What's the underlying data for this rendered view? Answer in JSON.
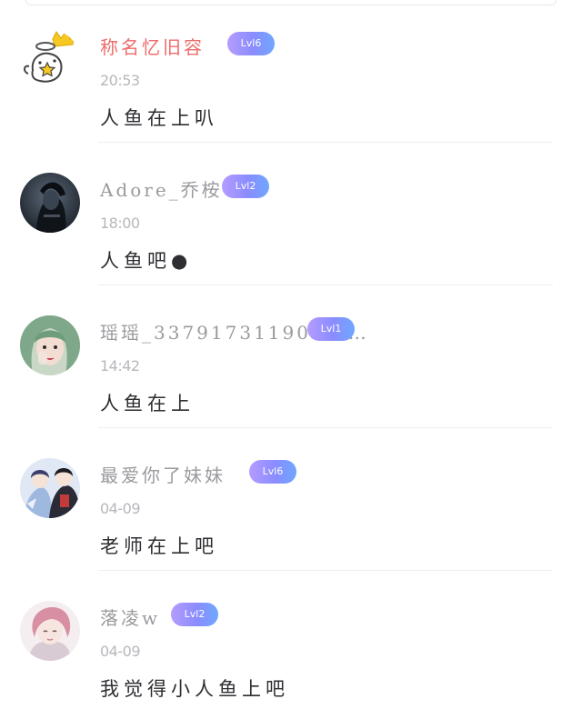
{
  "comments": [
    {
      "username": "称名忆旧容",
      "level": "Lvl6",
      "time": "20:53",
      "content": "人鱼在上叭",
      "avatar_icon": "angel-ghost-with-crown",
      "name_color": "#ef6b6b"
    },
    {
      "username": "Adore_乔桉",
      "level": "Lvl2",
      "time": "18:00",
      "content": "人鱼吧●",
      "avatar_icon": "dark-anime-portrait"
    },
    {
      "username": "瑶瑶_3379173119011 …",
      "level": "Lvl1",
      "time": "14:42",
      "content": "人鱼在上",
      "avatar_icon": "green-hair-girl-photo"
    },
    {
      "username": "最爱你了妹妹",
      "level": "Lvl6",
      "time": "04-09",
      "content": "老师在上吧",
      "avatar_icon": "anime-couple-illustration"
    },
    {
      "username": "落凌w",
      "level": "Lvl2",
      "time": "04-09",
      "content": "我觉得小人鱼上吧",
      "avatar_icon": "pink-hair-anime-boy"
    }
  ],
  "colors": {
    "level_badge_start": "#b59cff",
    "level_badge_end": "#6fa7ff",
    "name_default": "#9a9a9f",
    "time": "#b7b7bc",
    "content": "#2e2e33"
  }
}
